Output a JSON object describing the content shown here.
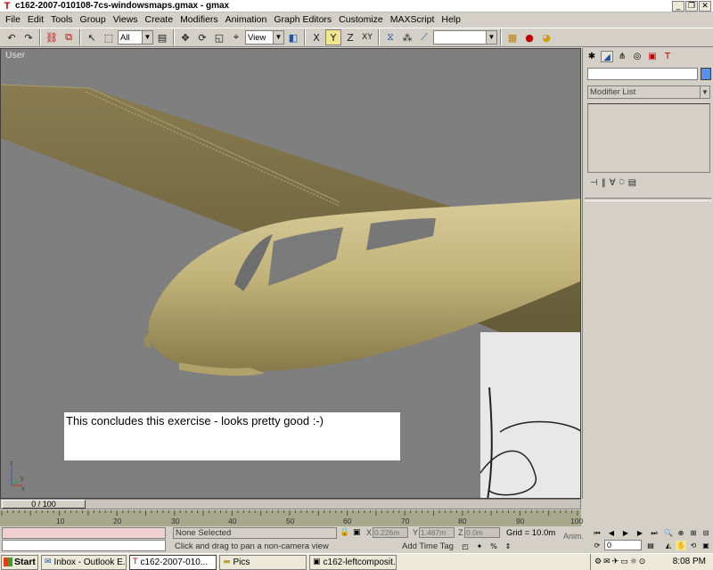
{
  "window": {
    "title": "c162-2007-010108-7cs-windowsmaps.gmax - gmax",
    "minimize": "_",
    "restore": "❐",
    "close": "✕"
  },
  "menu": {
    "items": [
      "File",
      "Edit",
      "Tools",
      "Group",
      "Views",
      "Create",
      "Modifiers",
      "Animation",
      "Graph Editors",
      "Customize",
      "MAXScript",
      "Help"
    ]
  },
  "toolbar": {
    "selection_filter": "All",
    "reference_coord": "View",
    "named_selection": ""
  },
  "viewport": {
    "label": "User",
    "caption": "This concludes this exercise - looks pretty good :-)",
    "axis_labels": {
      "x": "x",
      "y": "y",
      "z": "z"
    }
  },
  "command_panel": {
    "object_name": "",
    "object_color": "#5a8ee8",
    "modifier_list": "Modifier List"
  },
  "time": {
    "frame_display": "0 / 100",
    "ticks": [
      "10",
      "20",
      "30",
      "40",
      "50",
      "60",
      "70",
      "80",
      "90",
      "100"
    ],
    "current_frame": 0,
    "total_frames": 100
  },
  "status": {
    "selection": "None Selected",
    "prompt": "Click and drag to pan a non-camera view",
    "x_label": "X",
    "x_value": "0.226m",
    "y_label": "Y",
    "y_value": "1.467m",
    "z_label": "Z",
    "z_value": "0.0m",
    "grid": "Grid = 10.0m",
    "add_time_tag": "Add Time Tag",
    "anim": "Anim.",
    "frame_field": "0"
  },
  "taskbar": {
    "start": "Start",
    "tasks": [
      {
        "label": "Inbox - Outlook E...",
        "active": false
      },
      {
        "label": "c162-2007-010...",
        "active": true
      },
      {
        "label": "Pics",
        "active": false
      },
      {
        "label": "c162-leftcomposit...",
        "active": false
      }
    ],
    "clock": "8:08 PM"
  }
}
